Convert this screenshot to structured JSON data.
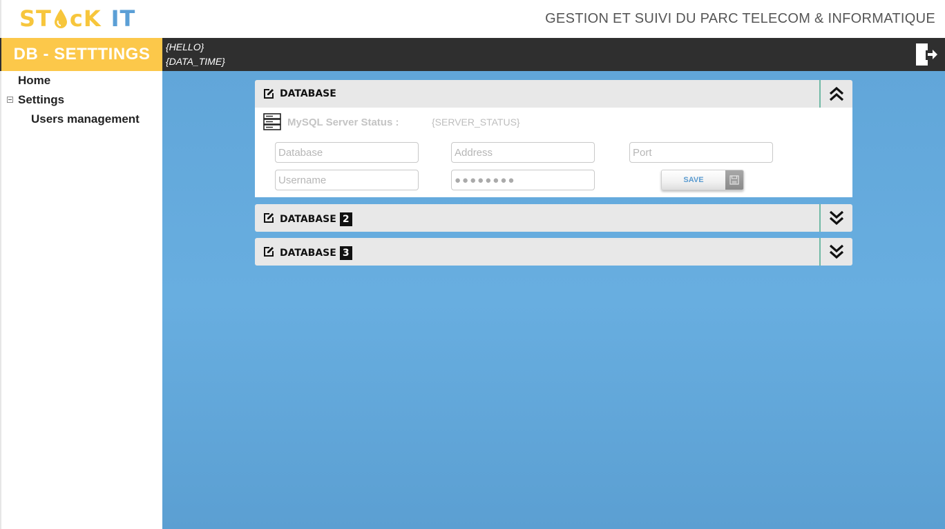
{
  "header": {
    "logo": {
      "part1": "ST",
      "part2": "cK",
      "part3": "IT"
    },
    "title": "GESTION ET SUIVI DU PARC TELECOM & INFORMATIQUE"
  },
  "topbar": {
    "page_title": "DB - SETTTINGS",
    "hello": "{HELLO}",
    "date_time": "{DATA_TIME}"
  },
  "sidebar": {
    "items": [
      {
        "label": "Home"
      },
      {
        "label": "Settings"
      },
      {
        "label": "Users management"
      }
    ]
  },
  "panels": [
    {
      "title": "DATABASE",
      "number": "",
      "expanded": true,
      "status_label": "MySQL Server Status :",
      "status_value": "{SERVER_STATUS}",
      "fields": {
        "database_placeholder": "Database",
        "address_placeholder": "Address",
        "port_placeholder": "Port",
        "username_placeholder": "Username",
        "password_value": "●●●●●●●●"
      },
      "save_label": "SAVE"
    },
    {
      "title": "DATABASE",
      "number": "2",
      "expanded": false
    },
    {
      "title": "DATABASE",
      "number": "3",
      "expanded": false
    }
  ],
  "colors": {
    "brand_yellow": "#fcc84a",
    "brand_blue": "#5b9fd6",
    "dark_bar": "#2f2f2f",
    "main_bg": "#64aadc",
    "toggle_border": "#6fb9a4"
  },
  "icons": [
    "logo-drop-icon",
    "logout-icon",
    "collapse-icon",
    "edit-icon",
    "server-icon",
    "chevron-double-up-icon",
    "chevron-double-down-icon",
    "floppy-disk-icon"
  ]
}
